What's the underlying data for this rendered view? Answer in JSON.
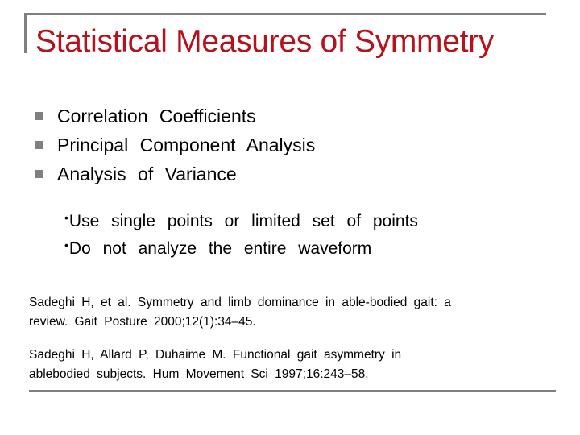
{
  "slide": {
    "title": "Statistical Measures of Symmetry",
    "title_color": "#b5121b",
    "bullets": [
      {
        "label": "Correlation  Coefficients"
      },
      {
        "label": "Principal  Component  Analysis"
      },
      {
        "label": "Analysis  of  Variance"
      }
    ],
    "sub_bullet_glyph": "•",
    "sub_bullets": [
      {
        "label": "Use single points or limited set of points"
      },
      {
        "label": "Do not analyze the entire waveform"
      }
    ],
    "references": [
      {
        "line1": "Sadeghi H, et al. Symmetry and limb dominance in able-bodied gait: a",
        "line2": "review. Gait Posture 2000;12(1):34–45."
      },
      {
        "line1": "Sadeghi H, Allard P, Duhaime M. Functional gait asymmetry in",
        "line2": "ablebodied subjects. Hum Movement Sci 1997;16:243–58."
      }
    ]
  }
}
